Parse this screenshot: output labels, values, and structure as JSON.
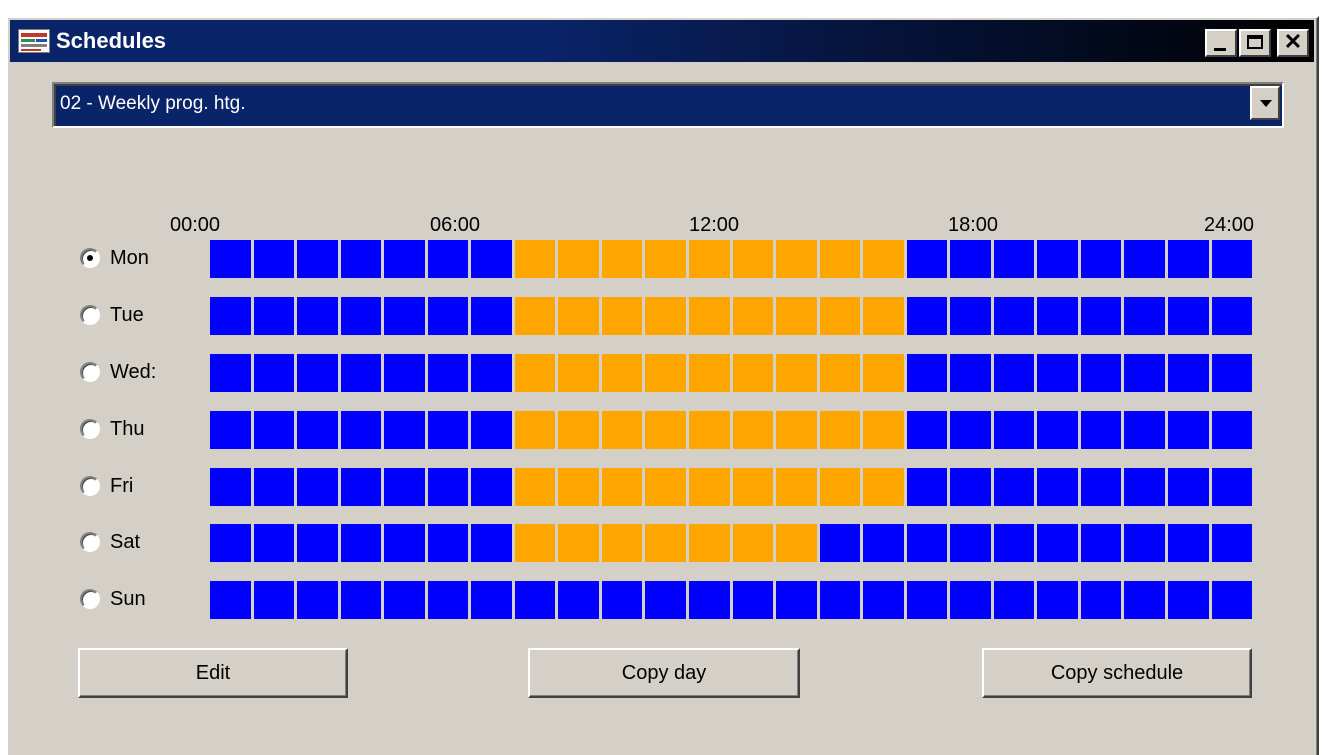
{
  "window": {
    "title": "Schedules",
    "minimize_icon": "minimize-icon",
    "maximize_icon": "maximize-icon",
    "close_icon": "close-icon",
    "close_glyph": "✕"
  },
  "schedule_select": {
    "value": "02 - Weekly prog. htg.",
    "arrow_icon": "chevron-down-icon"
  },
  "time_axis": [
    "00:00",
    "06:00",
    "12:00",
    "18:00",
    "24:00"
  ],
  "colors": {
    "off": "#0000ff",
    "on": "#ffa500"
  },
  "days": [
    {
      "label": "Mon",
      "selected": true,
      "on_blocks": [
        7,
        16
      ]
    },
    {
      "label": "Tue",
      "selected": false,
      "on_blocks": [
        7,
        16
      ]
    },
    {
      "label": "Wed:",
      "selected": false,
      "on_blocks": [
        7,
        16
      ]
    },
    {
      "label": "Thu",
      "selected": false,
      "on_blocks": [
        7,
        16
      ]
    },
    {
      "label": "Fri",
      "selected": false,
      "on_blocks": [
        7,
        16
      ]
    },
    {
      "label": "Sat",
      "selected": false,
      "on_blocks": [
        7,
        14
      ]
    },
    {
      "label": "Sun",
      "selected": false,
      "on_blocks": []
    }
  ],
  "hours_per_day": 24,
  "buttons": {
    "edit": "Edit",
    "copy_day": "Copy day",
    "copy_schedule": "Copy schedule"
  }
}
